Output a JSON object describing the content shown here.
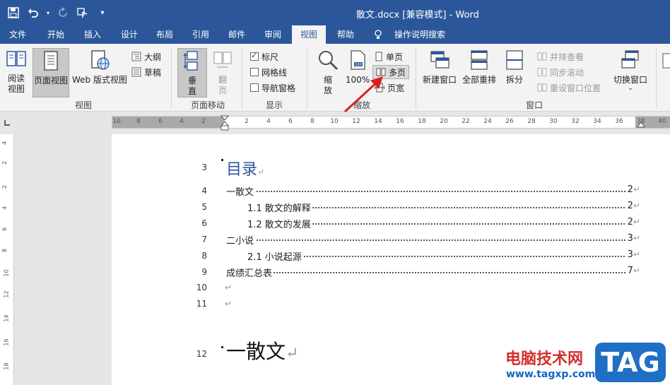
{
  "titlebar": {
    "title": "散文.docx [兼容模式]  -  Word",
    "undo_icon": "undo-icon",
    "redo_icon": "redo-icon",
    "save_icon": "save-icon",
    "touch_icon": "touch-mode-icon",
    "customize_icon": "customize-qat-icon"
  },
  "tabs": [
    "文件",
    "开始",
    "插入",
    "设计",
    "布局",
    "引用",
    "邮件",
    "审阅",
    "视图",
    "帮助",
    "操作说明搜索"
  ],
  "ribbon": {
    "views": {
      "group_label": "视图",
      "read_mode": "阅读视图",
      "print_layout": "页面视图",
      "web_layout": "Web 版式视图",
      "outline": "大纲",
      "draft": "草稿"
    },
    "page_movement": {
      "group_label": "页面移动",
      "vertical": "垂直",
      "side_to_side": "翻页"
    },
    "show": {
      "group_label": "显示",
      "ruler": "标尺",
      "ruler_checked": true,
      "gridlines": "网格线",
      "gridlines_checked": false,
      "nav_pane": "导航窗格",
      "nav_pane_checked": false
    },
    "zoom": {
      "group_label": "缩放",
      "zoom": "缩放",
      "hundred": "100%",
      "one_page": "单页",
      "multiple_pages": "多页",
      "page_width": "页宽"
    },
    "window": {
      "group_label": "窗口",
      "new_window": "新建窗口",
      "arrange_all": "全部重排",
      "split": "拆分",
      "side_by_side": "并排查看",
      "sync_scroll": "同步滚动",
      "reset_pos": "重设窗口位置",
      "switch_windows": "切换窗口"
    }
  },
  "ruler": {
    "marks": [
      "10",
      "8",
      "6",
      "4",
      "2",
      "2",
      "4",
      "6",
      "8",
      "10",
      "12",
      "14",
      "16",
      "18",
      "20",
      "22",
      "24",
      "26",
      "28",
      "30",
      "32",
      "34",
      "36",
      "38",
      "40"
    ],
    "vmarks": [
      "4",
      "2",
      "2",
      "4",
      "6",
      "8",
      "10",
      "12",
      "14",
      "16",
      "18"
    ]
  },
  "document": {
    "toc_title": "目录",
    "return_mark": "↵",
    "line_numbers": [
      "3",
      "4",
      "5",
      "6",
      "7",
      "8",
      "9",
      "10",
      "11",
      "12"
    ],
    "toc": [
      {
        "text": "一散文",
        "page": "2",
        "indent": 0
      },
      {
        "text": "1.1 散文的解释",
        "page": "2",
        "indent": 1
      },
      {
        "text": "1.2 散文的发展",
        "page": "2",
        "indent": 1
      },
      {
        "text": "二小说",
        "page": "3",
        "indent": 0
      },
      {
        "text": "2.1 小说起源",
        "page": "3",
        "indent": 1
      },
      {
        "text": "成绩汇总表",
        "page": "7",
        "indent": 0
      }
    ],
    "heading": "一散文"
  },
  "watermark": {
    "site_name": "电脑技术网",
    "url": "www.tagxp.com",
    "logo": "TAG"
  }
}
